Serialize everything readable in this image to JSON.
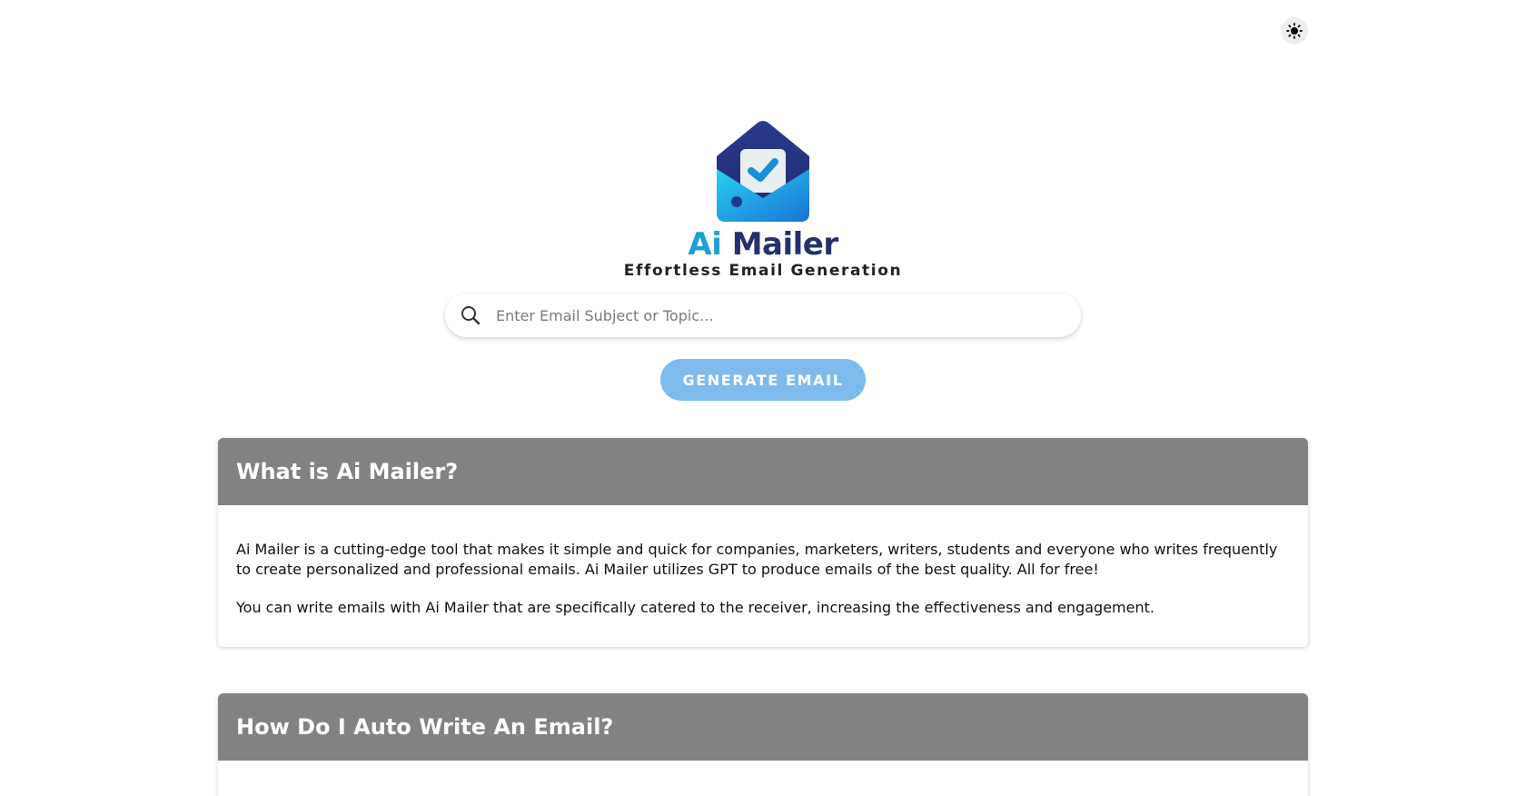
{
  "brand": {
    "name_part1": "Ai",
    "name_part2": "Mailer",
    "tagline": "Effortless Email Generation",
    "colors": {
      "ai": "#1f9fd8",
      "mailer": "#24306f"
    }
  },
  "theme_toggle": {
    "icon": "sun-icon"
  },
  "search": {
    "icon": "search-icon",
    "placeholder": "Enter Email Subject or Topic...",
    "value": ""
  },
  "generate": {
    "label": "GENERATE EMAIL",
    "color": "#7ebbec"
  },
  "sections": [
    {
      "title": "What is Ai Mailer?",
      "paragraphs": [
        "Ai Mailer is a cutting-edge tool that makes it simple and quick for companies, marketers, writers, students and everyone who writes frequently to create personalized and professional emails. Ai Mailer utilizes GPT to produce emails of the best quality. All for free!",
        "You can write emails with Ai Mailer that are specifically catered to the receiver, increasing the effectiveness and engagement."
      ]
    },
    {
      "title": "How Do I Auto Write An Email?",
      "paragraphs": []
    }
  ],
  "colors": {
    "card_header": "#828282"
  }
}
